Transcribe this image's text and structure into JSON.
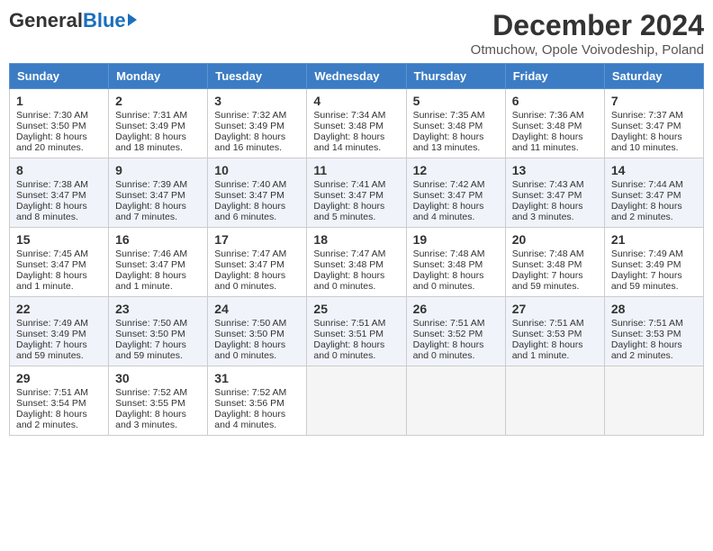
{
  "header": {
    "logo_general": "General",
    "logo_blue": "Blue",
    "month_title": "December 2024",
    "location": "Otmuchow, Opole Voivodeship, Poland"
  },
  "days_of_week": [
    "Sunday",
    "Monday",
    "Tuesday",
    "Wednesday",
    "Thursday",
    "Friday",
    "Saturday"
  ],
  "weeks": [
    [
      {
        "day": "1",
        "sunrise": "Sunrise: 7:30 AM",
        "sunset": "Sunset: 3:50 PM",
        "daylight": "Daylight: 8 hours and 20 minutes."
      },
      {
        "day": "2",
        "sunrise": "Sunrise: 7:31 AM",
        "sunset": "Sunset: 3:49 PM",
        "daylight": "Daylight: 8 hours and 18 minutes."
      },
      {
        "day": "3",
        "sunrise": "Sunrise: 7:32 AM",
        "sunset": "Sunset: 3:49 PM",
        "daylight": "Daylight: 8 hours and 16 minutes."
      },
      {
        "day": "4",
        "sunrise": "Sunrise: 7:34 AM",
        "sunset": "Sunset: 3:48 PM",
        "daylight": "Daylight: 8 hours and 14 minutes."
      },
      {
        "day": "5",
        "sunrise": "Sunrise: 7:35 AM",
        "sunset": "Sunset: 3:48 PM",
        "daylight": "Daylight: 8 hours and 13 minutes."
      },
      {
        "day": "6",
        "sunrise": "Sunrise: 7:36 AM",
        "sunset": "Sunset: 3:48 PM",
        "daylight": "Daylight: 8 hours and 11 minutes."
      },
      {
        "day": "7",
        "sunrise": "Sunrise: 7:37 AM",
        "sunset": "Sunset: 3:47 PM",
        "daylight": "Daylight: 8 hours and 10 minutes."
      }
    ],
    [
      {
        "day": "8",
        "sunrise": "Sunrise: 7:38 AM",
        "sunset": "Sunset: 3:47 PM",
        "daylight": "Daylight: 8 hours and 8 minutes."
      },
      {
        "day": "9",
        "sunrise": "Sunrise: 7:39 AM",
        "sunset": "Sunset: 3:47 PM",
        "daylight": "Daylight: 8 hours and 7 minutes."
      },
      {
        "day": "10",
        "sunrise": "Sunrise: 7:40 AM",
        "sunset": "Sunset: 3:47 PM",
        "daylight": "Daylight: 8 hours and 6 minutes."
      },
      {
        "day": "11",
        "sunrise": "Sunrise: 7:41 AM",
        "sunset": "Sunset: 3:47 PM",
        "daylight": "Daylight: 8 hours and 5 minutes."
      },
      {
        "day": "12",
        "sunrise": "Sunrise: 7:42 AM",
        "sunset": "Sunset: 3:47 PM",
        "daylight": "Daylight: 8 hours and 4 minutes."
      },
      {
        "day": "13",
        "sunrise": "Sunrise: 7:43 AM",
        "sunset": "Sunset: 3:47 PM",
        "daylight": "Daylight: 8 hours and 3 minutes."
      },
      {
        "day": "14",
        "sunrise": "Sunrise: 7:44 AM",
        "sunset": "Sunset: 3:47 PM",
        "daylight": "Daylight: 8 hours and 2 minutes."
      }
    ],
    [
      {
        "day": "15",
        "sunrise": "Sunrise: 7:45 AM",
        "sunset": "Sunset: 3:47 PM",
        "daylight": "Daylight: 8 hours and 1 minute."
      },
      {
        "day": "16",
        "sunrise": "Sunrise: 7:46 AM",
        "sunset": "Sunset: 3:47 PM",
        "daylight": "Daylight: 8 hours and 1 minute."
      },
      {
        "day": "17",
        "sunrise": "Sunrise: 7:47 AM",
        "sunset": "Sunset: 3:47 PM",
        "daylight": "Daylight: 8 hours and 0 minutes."
      },
      {
        "day": "18",
        "sunrise": "Sunrise: 7:47 AM",
        "sunset": "Sunset: 3:48 PM",
        "daylight": "Daylight: 8 hours and 0 minutes."
      },
      {
        "day": "19",
        "sunrise": "Sunrise: 7:48 AM",
        "sunset": "Sunset: 3:48 PM",
        "daylight": "Daylight: 8 hours and 0 minutes."
      },
      {
        "day": "20",
        "sunrise": "Sunrise: 7:48 AM",
        "sunset": "Sunset: 3:48 PM",
        "daylight": "Daylight: 7 hours and 59 minutes."
      },
      {
        "day": "21",
        "sunrise": "Sunrise: 7:49 AM",
        "sunset": "Sunset: 3:49 PM",
        "daylight": "Daylight: 7 hours and 59 minutes."
      }
    ],
    [
      {
        "day": "22",
        "sunrise": "Sunrise: 7:49 AM",
        "sunset": "Sunset: 3:49 PM",
        "daylight": "Daylight: 7 hours and 59 minutes."
      },
      {
        "day": "23",
        "sunrise": "Sunrise: 7:50 AM",
        "sunset": "Sunset: 3:50 PM",
        "daylight": "Daylight: 7 hours and 59 minutes."
      },
      {
        "day": "24",
        "sunrise": "Sunrise: 7:50 AM",
        "sunset": "Sunset: 3:50 PM",
        "daylight": "Daylight: 8 hours and 0 minutes."
      },
      {
        "day": "25",
        "sunrise": "Sunrise: 7:51 AM",
        "sunset": "Sunset: 3:51 PM",
        "daylight": "Daylight: 8 hours and 0 minutes."
      },
      {
        "day": "26",
        "sunrise": "Sunrise: 7:51 AM",
        "sunset": "Sunset: 3:52 PM",
        "daylight": "Daylight: 8 hours and 0 minutes."
      },
      {
        "day": "27",
        "sunrise": "Sunrise: 7:51 AM",
        "sunset": "Sunset: 3:53 PM",
        "daylight": "Daylight: 8 hours and 1 minute."
      },
      {
        "day": "28",
        "sunrise": "Sunrise: 7:51 AM",
        "sunset": "Sunset: 3:53 PM",
        "daylight": "Daylight: 8 hours and 2 minutes."
      }
    ],
    [
      {
        "day": "29",
        "sunrise": "Sunrise: 7:51 AM",
        "sunset": "Sunset: 3:54 PM",
        "daylight": "Daylight: 8 hours and 2 minutes."
      },
      {
        "day": "30",
        "sunrise": "Sunrise: 7:52 AM",
        "sunset": "Sunset: 3:55 PM",
        "daylight": "Daylight: 8 hours and 3 minutes."
      },
      {
        "day": "31",
        "sunrise": "Sunrise: 7:52 AM",
        "sunset": "Sunset: 3:56 PM",
        "daylight": "Daylight: 8 hours and 4 minutes."
      },
      null,
      null,
      null,
      null
    ]
  ]
}
